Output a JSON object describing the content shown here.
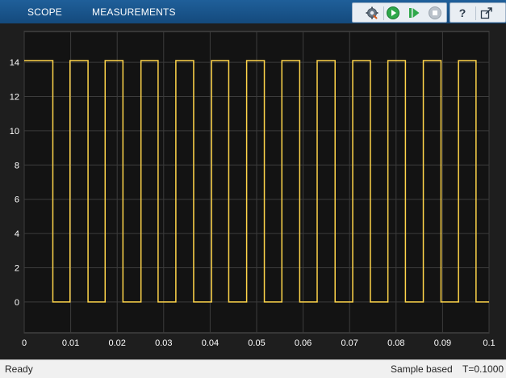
{
  "toolbar": {
    "tabs": [
      {
        "label": "SCOPE"
      },
      {
        "label": "MEASUREMENTS"
      }
    ],
    "buttons": {
      "settings_icon": "gear-settings-icon",
      "run_icon": "play-icon",
      "step_icon": "step-forward-icon",
      "stop_icon": "stop-icon",
      "help_icon": "question-icon",
      "undock_icon": "undock-icon"
    },
    "accent": "#1a5a96"
  },
  "status": {
    "ready": "Ready",
    "mode": "Sample based",
    "time": "T=0.1000"
  },
  "chart_data": {
    "type": "line",
    "x_ticks": [
      "0",
      "0.01",
      "0.02",
      "0.03",
      "0.04",
      "0.05",
      "0.06",
      "0.07",
      "0.08",
      "0.09",
      "0.1"
    ],
    "y_ticks": [
      "0",
      "2",
      "4",
      "6",
      "8",
      "10",
      "12",
      "14"
    ],
    "xlim": [
      0,
      0.1
    ],
    "ylim": [
      -1.8,
      15.8
    ],
    "grid": true,
    "line_color": "#ffd54a",
    "background": "#131313",
    "series": [
      {
        "x": [
          0,
          0.00616,
          0.00616,
          0.00985,
          0.00985,
          0.01373,
          0.01373,
          0.01741,
          0.01741,
          0.02124,
          0.02124,
          0.02512,
          0.02512,
          0.0288,
          0.0288,
          0.03262,
          0.03262,
          0.03645,
          0.03645,
          0.0403,
          0.0403,
          0.044,
          0.044,
          0.04785,
          0.04785,
          0.05166,
          0.05166,
          0.05543,
          0.05543,
          0.05927,
          0.05927,
          0.06302,
          0.06302,
          0.06688,
          0.06688,
          0.07067,
          0.07067,
          0.07447,
          0.07447,
          0.07824,
          0.07824,
          0.08201,
          0.08201,
          0.08586,
          0.08586,
          0.08966,
          0.08966,
          0.09343,
          0.09343,
          0.0972,
          0.0972,
          0.1
        ],
        "y": [
          14.1,
          14.1,
          0,
          0,
          14.1,
          14.1,
          0,
          0,
          14.1,
          14.1,
          0,
          0,
          14.1,
          14.1,
          0,
          0,
          14.1,
          14.1,
          0,
          0,
          14.1,
          14.1,
          0,
          0,
          14.1,
          14.1,
          0,
          0,
          14.1,
          14.1,
          0,
          0,
          14.1,
          14.1,
          0,
          0,
          14.1,
          14.1,
          0,
          0,
          14.1,
          14.1,
          0,
          0,
          14.1,
          14.1,
          0,
          0,
          14.1,
          14.1,
          0,
          0
        ]
      }
    ]
  }
}
